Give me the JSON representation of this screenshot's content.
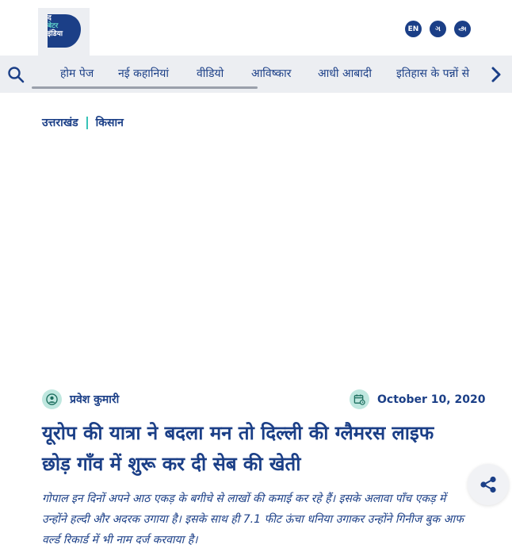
{
  "header": {
    "logo": {
      "line1": "द",
      "line2": "बेटर",
      "line3": "इंडिया"
    },
    "languages": [
      "EN",
      "ગ",
      "அ"
    ]
  },
  "nav": {
    "items": [
      "होम पेज",
      "नई कहानियां",
      "वीडियो",
      "आविष्कार",
      "आधी आबादी",
      "इतिहास के पन्नों से"
    ]
  },
  "breadcrumb": {
    "items": [
      "उत्तराखंड",
      "किसान"
    ]
  },
  "article": {
    "author": "प्रवेश कुमारी",
    "date": "October 10, 2020",
    "title": "यूरोप की यात्रा ने बदला मन तो दिल्ली की ग्लैमरस लाइफ छोड़ गाँव में शुरू कर दी सेब की खेती",
    "excerpt": "गोपाल इन दिनों अपने आठ एकड़ के बगीचे से लाखों की कमाई कर रहे हैं। इसके अलावा पाँच एकड़ में उन्होंने हल्दी और अदरक उगाया है। इसके साथ ही 7.1 फीट ऊंचा धनिया उगाकर उन्होंने गिनीज बुक आफ वर्ल्ड रिकार्ड में भी नाम दर्ज करवाया है।"
  },
  "colors": {
    "brand": "#1b3f87",
    "accent": "#38c3b7",
    "nav_bg": "#eceef2"
  },
  "icons": {
    "search": "search-icon",
    "next": "chevron-right-icon",
    "author": "user-icon",
    "date": "calendar-icon",
    "share": "share-icon"
  }
}
